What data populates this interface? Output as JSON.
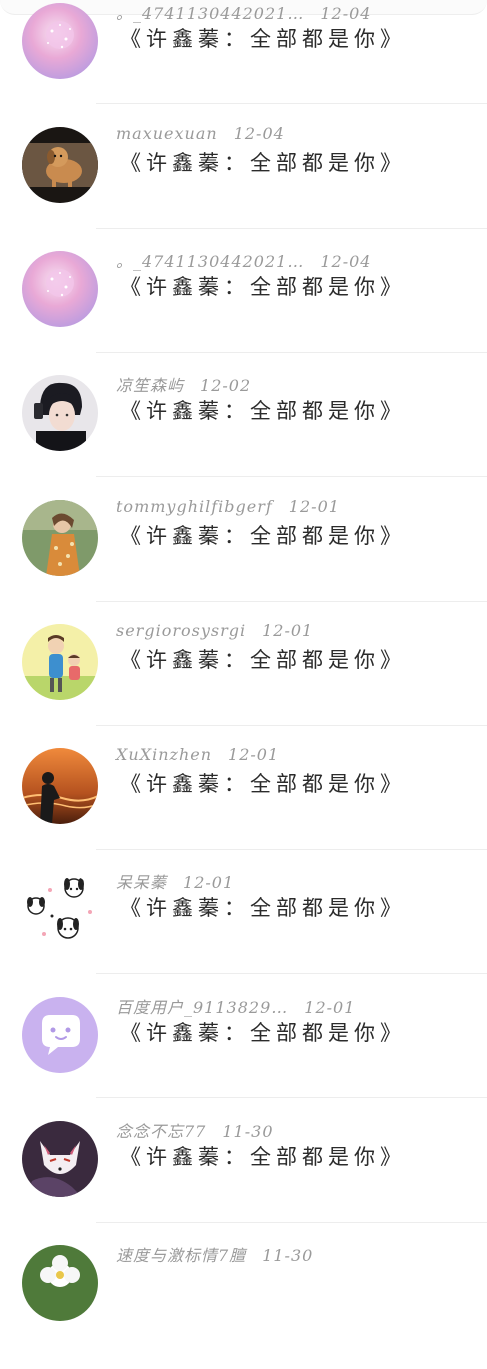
{
  "comments": [
    {
      "username": "。_4741130442021…",
      "date": "12-04",
      "text": "《许鑫蓁：全部都是你》",
      "avatar": "pink-sparkle-avatar"
    },
    {
      "username": "maxuexuan",
      "date": "12-04",
      "text": "《许鑫蓁：全部都是你》",
      "avatar": "puppy-photo-avatar"
    },
    {
      "username": "。_4741130442021…",
      "date": "12-04",
      "text": "《许鑫蓁：全部都是你》",
      "avatar": "pink-sparkle-avatar"
    },
    {
      "username": "凉笙森屿",
      "date": "12-02",
      "text": "《许鑫蓁：全部都是你》",
      "avatar": "anime-boy-avatar"
    },
    {
      "username": "tommyghilfibgerf",
      "date": "12-01",
      "text": "《许鑫蓁：全部都是你》",
      "avatar": "girl-flowers-avatar"
    },
    {
      "username": "sergiorosysrgi",
      "date": "12-01",
      "text": "《许鑫蓁：全部都是你》",
      "avatar": "cartoon-family-avatar"
    },
    {
      "username": "XuXinzhen",
      "date": "12-01",
      "text": "《许鑫蓁：全部都是你》",
      "avatar": "sunset-silhouette-avatar"
    },
    {
      "username": "呆呆蓁",
      "date": "12-01",
      "text": "《许鑫蓁：全部都是你》",
      "avatar": "cartoon-dogs-avatar"
    },
    {
      "username": "百度用户_9113829…",
      "date": "12-01",
      "text": "《许鑫蓁：全部都是你》",
      "avatar": "default-chat-avatar"
    },
    {
      "username": "念念不忘77",
      "date": "11-30",
      "text": "《许鑫蓁：全部都是你》",
      "avatar": "fox-mask-avatar"
    },
    {
      "username": "速度与激标情7膻",
      "date": "11-30",
      "text": "",
      "avatar": "white-flower-avatar"
    }
  ]
}
